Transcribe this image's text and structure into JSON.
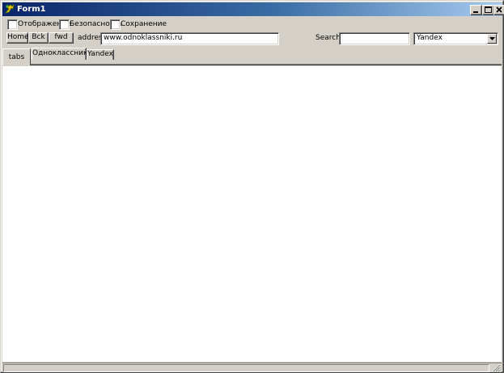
{
  "window": {
    "title": "Form1"
  },
  "options": {
    "display_label": "Отображение",
    "security_label": "Безопасность",
    "save_label": "Сохранение"
  },
  "nav": {
    "home_label": "Home",
    "back_label": "Bck",
    "forward_label": "fwd",
    "address_label": "addres:",
    "address_value": "www.odnoklassniki.ru",
    "search_label": "Search:",
    "search_value": "",
    "engine_selected": "Yandex"
  },
  "tabs": [
    {
      "label": "tabs"
    },
    {
      "label": "Одноклассники"
    },
    {
      "label": "Yandex"
    }
  ],
  "colors": {
    "face": "#d4d0c8",
    "title_start": "#0a246a",
    "title_end": "#a6caf0"
  }
}
